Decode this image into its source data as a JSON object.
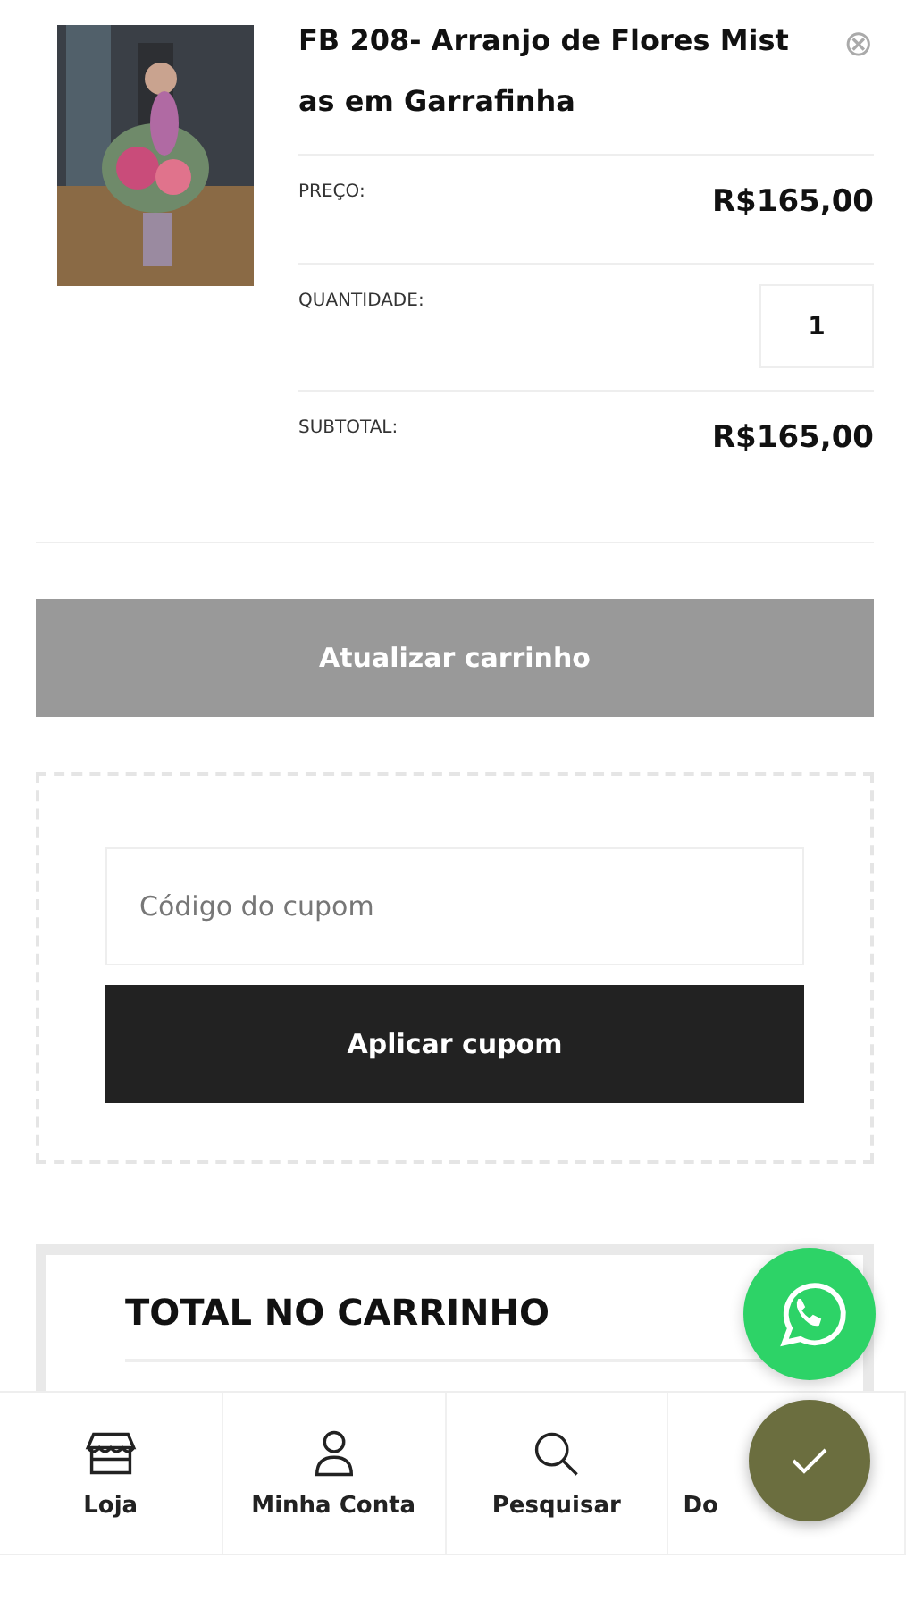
{
  "cart_item": {
    "title": "FB 208- Arranjo de Flores Mist as em Garrafinha",
    "remove": "⊗",
    "rows": [
      {
        "kind": "text",
        "label": "PREÇO:",
        "value": "R$165,00"
      },
      {
        "kind": "quantity",
        "label": "QUANTIDADE:",
        "value": "1"
      },
      {
        "kind": "text",
        "label": "SUBTOTAL:",
        "value": "R$165,00"
      }
    ]
  },
  "update_button": "Atualizar carrinho",
  "coupon": {
    "placeholder": "Código do cupom",
    "button": "Aplicar cupom"
  },
  "totals": {
    "title": "TOTAL NO CARRINHO"
  },
  "bottom_nav": [
    {
      "kind": "store",
      "label": "Loja"
    },
    {
      "kind": "user",
      "label": "Minha Conta"
    },
    {
      "kind": "search",
      "label": "Pesquisar"
    },
    {
      "kind": "none",
      "label": "Do"
    }
  ]
}
